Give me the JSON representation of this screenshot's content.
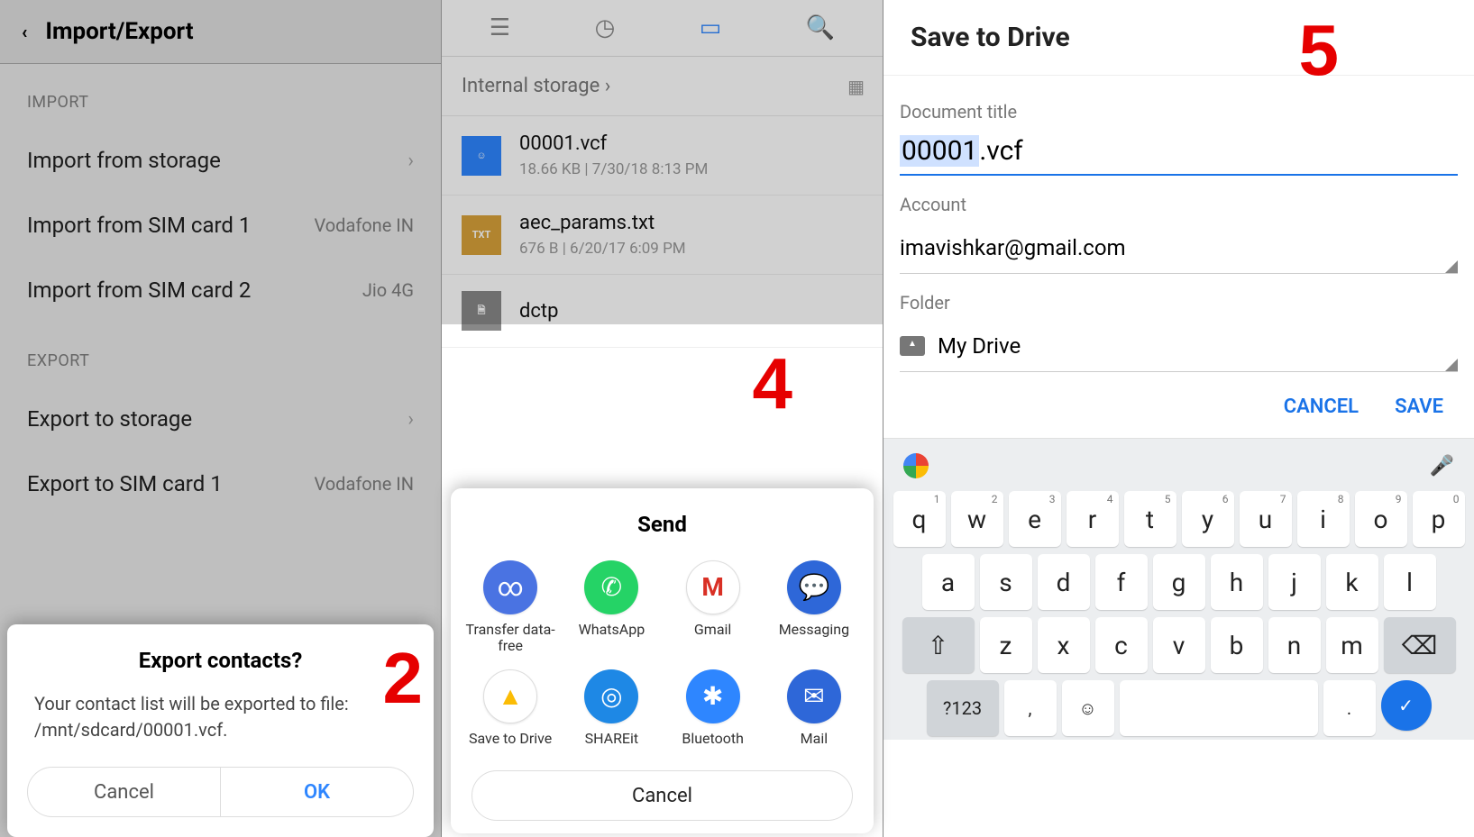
{
  "panel1": {
    "header": "Import/Export",
    "section_import": "IMPORT",
    "items_import": [
      {
        "label": "Import from storage",
        "meta": ""
      },
      {
        "label": "Import from SIM card 1",
        "meta": "Vodafone IN"
      },
      {
        "label": "Import from SIM card 2",
        "meta": "Jio 4G"
      }
    ],
    "section_export": "EXPORT",
    "items_export": [
      {
        "label": "Export to storage",
        "meta": ""
      },
      {
        "label": "Export to SIM card 1",
        "meta": "Vodafone IN"
      }
    ],
    "dialog": {
      "title": "Export contacts?",
      "body": "Your contact list will be exported to file: /mnt/sdcard/00001.vcf.",
      "cancel": "Cancel",
      "ok": "OK"
    },
    "step": "2"
  },
  "panel2": {
    "breadcrumb": "Internal storage ›",
    "files": [
      {
        "name": "00001.vcf",
        "meta": "18.66 KB  |  7/30/18 8:13 PM",
        "type": "vcf",
        "glyph": "☺"
      },
      {
        "name": "aec_params.txt",
        "meta": "676 B  |  6/20/17 6:09 PM",
        "type": "txt",
        "glyph": "TXT"
      },
      {
        "name": "dctp",
        "meta": "",
        "type": "gen",
        "glyph": "🗎"
      }
    ],
    "sheet": {
      "title": "Send",
      "row1": [
        {
          "label": "Transfer data-free",
          "color": "c-blue",
          "glyph": "∞"
        },
        {
          "label": "WhatsApp",
          "color": "c-green",
          "glyph": "✆"
        },
        {
          "label": "Gmail",
          "color": "c-white",
          "glyph": "M"
        },
        {
          "label": "Messaging",
          "color": "c-msg",
          "glyph": "💬"
        }
      ],
      "row2": [
        {
          "label": "Save to Drive",
          "color": "c-white",
          "glyph": "▲"
        },
        {
          "label": "SHAREit",
          "color": "c-share",
          "glyph": "◎"
        },
        {
          "label": "Bluetooth",
          "color": "c-bt",
          "glyph": "✱"
        },
        {
          "label": "Mail",
          "color": "c-msg",
          "glyph": "✉"
        }
      ],
      "cancel": "Cancel"
    },
    "step": "4"
  },
  "panel3": {
    "header": "Save to Drive",
    "form": {
      "title_label": "Document title",
      "title_highlight": "00001",
      "title_rest": ".vcf",
      "account_label": "Account",
      "account_value": "imavishkar@gmail.com",
      "folder_label": "Folder",
      "folder_value": "My Drive"
    },
    "actions": {
      "cancel": "CANCEL",
      "save": "SAVE"
    },
    "keyboard": {
      "row1": [
        [
          "q",
          "1"
        ],
        [
          "w",
          "2"
        ],
        [
          "e",
          "3"
        ],
        [
          "r",
          "4"
        ],
        [
          "t",
          "5"
        ],
        [
          "y",
          "6"
        ],
        [
          "u",
          "7"
        ],
        [
          "i",
          "8"
        ],
        [
          "o",
          "9"
        ],
        [
          "p",
          "0"
        ]
      ],
      "row2": [
        "a",
        "s",
        "d",
        "f",
        "g",
        "h",
        "j",
        "k",
        "l"
      ],
      "row3": [
        "z",
        "x",
        "c",
        "v",
        "b",
        "n",
        "m"
      ],
      "symbols": "?123",
      "comma": ",",
      "period": "."
    },
    "step": "5"
  }
}
